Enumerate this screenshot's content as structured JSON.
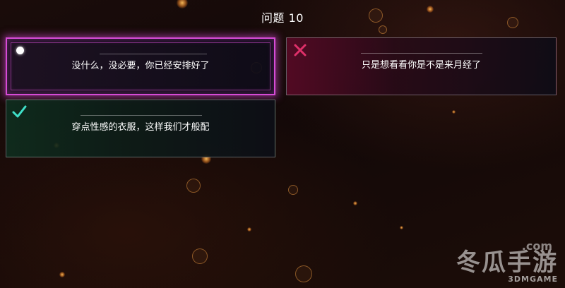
{
  "question": {
    "title": "问题 10"
  },
  "options": [
    {
      "text": "没什么，没必要，你已经安排好了",
      "state": "selected",
      "icon": "circle-dot-icon",
      "accent": "#d64bd6"
    },
    {
      "text": "只是想看看你是不是来月经了",
      "state": "wrong",
      "icon": "cross-icon",
      "accent": "#e0306a"
    },
    {
      "text": "穿点性感的衣服，这样我们才般配",
      "state": "correct",
      "icon": "check-icon",
      "accent": "#3fe0c8"
    }
  ],
  "watermark": {
    "main": "冬瓜手游",
    "url": ".com",
    "sub": "3DMGAME"
  }
}
